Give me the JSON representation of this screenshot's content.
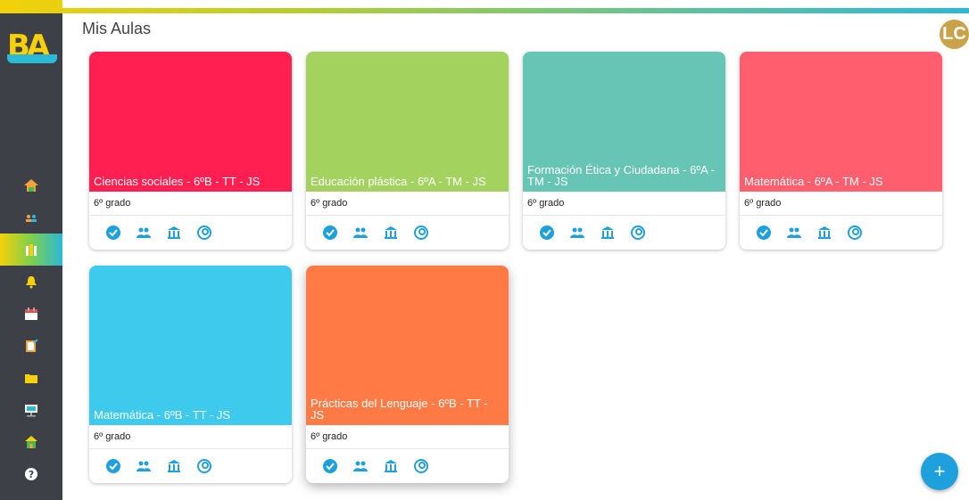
{
  "header": {
    "title": "Mis Aulas",
    "avatar_initials": "LC"
  },
  "logo": {
    "text": "BA"
  },
  "sidebar": {
    "items": [
      {
        "name": "home",
        "icon": "home-icon"
      },
      {
        "name": "students",
        "icon": "students-icon"
      },
      {
        "name": "classrooms",
        "icon": "classroom-icon",
        "active": true
      },
      {
        "name": "notifications",
        "icon": "bell-icon"
      },
      {
        "name": "calendar",
        "icon": "calendar-icon"
      },
      {
        "name": "tasks",
        "icon": "clipboard-icon"
      },
      {
        "name": "files",
        "icon": "folder-icon"
      },
      {
        "name": "training",
        "icon": "presentation-icon"
      },
      {
        "name": "school",
        "icon": "school-icon"
      },
      {
        "name": "help",
        "icon": "help-icon"
      }
    ]
  },
  "classes": [
    {
      "title": "Ciencias sociales - 6ºB - TT - JS",
      "grade": "6º grado",
      "color": "#ff1f51"
    },
    {
      "title": "Educación plástica - 6ºA - TM - JS",
      "grade": "6º grado",
      "color": "#a3d25e"
    },
    {
      "title": "Formación Ética y Ciudadana - 6ºA - TM - JS",
      "grade": "6º grado",
      "color": "#66c5b4"
    },
    {
      "title": "Matemática - 6ºA - TM - JS",
      "grade": "6º grado",
      "color": "#ff5e6e"
    },
    {
      "title": "Matemática - 6ºB - TT - JS",
      "grade": "6º grado",
      "color": "#3ecaec"
    },
    {
      "title": "Prácticas del Lenguaje - 6ºB - TT - JS",
      "grade": "6º grado",
      "color": "#ff7a45"
    }
  ],
  "fab": {
    "label": "+"
  },
  "colors": {
    "accent": "#1ea0dd",
    "sidebar": "#3d4046"
  }
}
